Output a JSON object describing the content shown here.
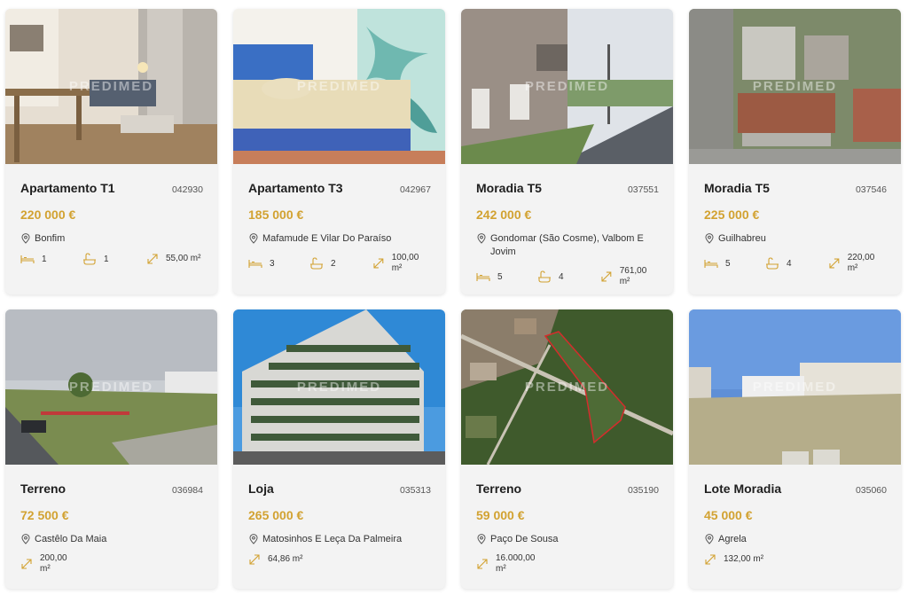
{
  "accent_color": "#d2a231",
  "watermark": "PREDIMED",
  "listings": [
    {
      "title": "Apartamento T1",
      "ref": "042930",
      "price": "220 000 €",
      "location": "Bonfim",
      "bedrooms": "1",
      "bathrooms": "1",
      "area": "55,00 m²"
    },
    {
      "title": "Apartamento T3",
      "ref": "042967",
      "price": "185 000 €",
      "location": "Mafamude E Vilar Do Paraíso",
      "bedrooms": "3",
      "bathrooms": "2",
      "area": "100,00 m²"
    },
    {
      "title": "Moradia T5",
      "ref": "037551",
      "price": "242 000 €",
      "location": "Gondomar (São Cosme), Valbom E Jovim",
      "bedrooms": "5",
      "bathrooms": "4",
      "area": "761,00 m²"
    },
    {
      "title": "Moradia T5",
      "ref": "037546",
      "price": "225 000 €",
      "location": "Guilhabreu",
      "bedrooms": "5",
      "bathrooms": "4",
      "area": "220,00 m²"
    },
    {
      "title": "Terreno",
      "ref": "036984",
      "price": "72 500 €",
      "location": "Castêlo Da Maia",
      "area": "200,00 m²"
    },
    {
      "title": "Loja",
      "ref": "035313",
      "price": "265 000 €",
      "location": "Matosinhos E Leça Da Palmeira",
      "area": "64,86 m²"
    },
    {
      "title": "Terreno",
      "ref": "035190",
      "price": "59 000 €",
      "location": "Paço De Sousa",
      "area": "16.000,00 m²"
    },
    {
      "title": "Lote Moradia",
      "ref": "035060",
      "price": "45 000 €",
      "location": "Agrela",
      "area": "132,00 m²"
    }
  ]
}
